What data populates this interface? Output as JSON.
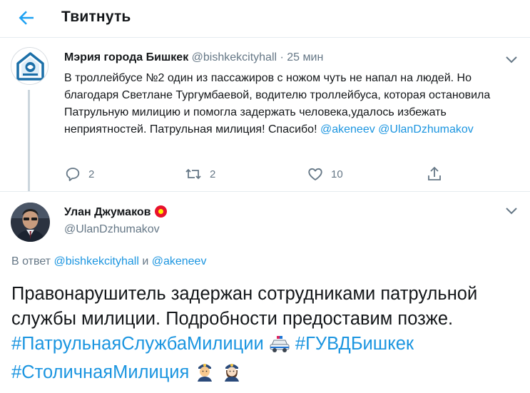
{
  "header": {
    "title": "Твитнуть",
    "back_icon": "arrow-left-icon"
  },
  "quoted_tweet": {
    "author_name": "Мэрия города Бишкек",
    "handle": "@bishkekcityhall",
    "separator": " · ",
    "time": "25 мин",
    "body_text": "В троллейбусе №2 один из пассажиров с ножом чуть не напал на людей. Но благодаря Светлане Тургумбаевой, водителю троллейбуса, которая остановила Патрульную милицию и помогла задержать человека,удалось избежать неприятностей. Патрульная милиция! Спасибо!",
    "mentions": [
      "@akeneev",
      "@UlanDzhumakov"
    ],
    "actions": {
      "reply_count": "2",
      "retweet_count": "2",
      "like_count": "10"
    }
  },
  "main_tweet": {
    "author_name": "Улан Джумаков",
    "handle": "@UlanDzhumakov",
    "reply_prefix": "В ответ",
    "reply_to_1": "@bishkekcityhall",
    "reply_and": "и",
    "reply_to_2": "@akeneev",
    "body_text": "Правонарушитель задержан сотрудниками патрульной службы милиции. Подробности предоставим позже.",
    "hashtags": [
      "#ПатрульнаяСлужбаМилиции",
      "#ГУВДБишкек",
      "#СтоличнаяМилиция"
    ]
  },
  "colors": {
    "accent": "#1da1f2",
    "link": "#1b95e0",
    "muted": "#657786",
    "divider": "#e6ecf0"
  }
}
